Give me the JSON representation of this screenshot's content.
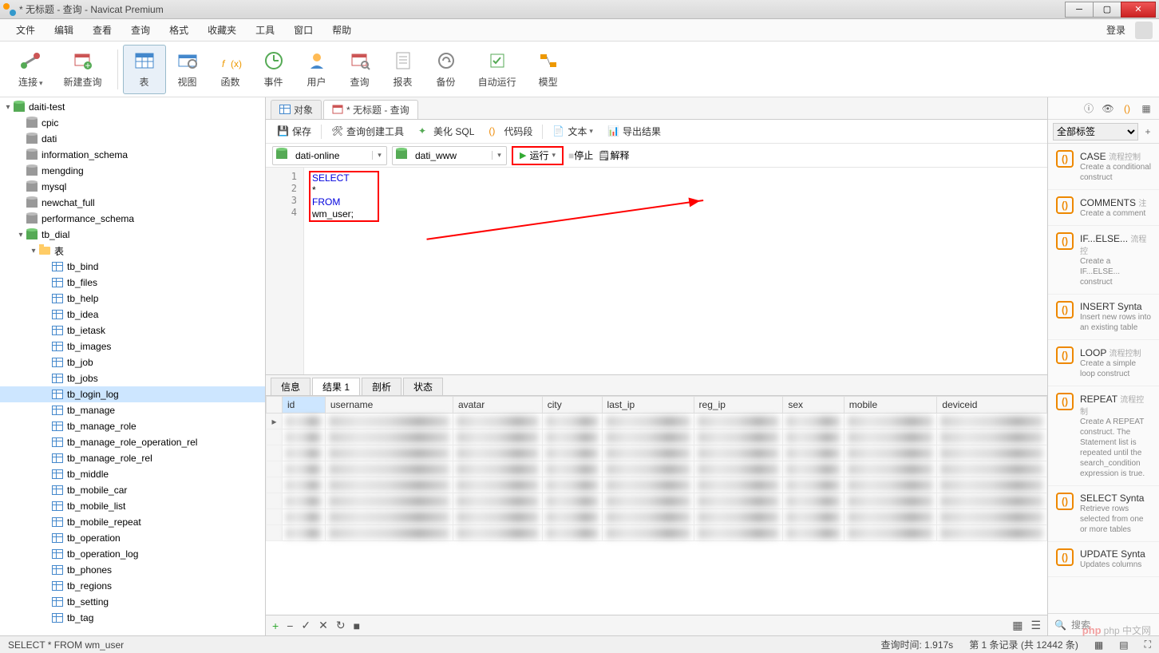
{
  "window": {
    "title": "* 无标题 - 查询 - Navicat Premium"
  },
  "menu": {
    "items": [
      "文件",
      "编辑",
      "查看",
      "查询",
      "格式",
      "收藏夹",
      "工具",
      "窗口",
      "帮助"
    ],
    "login": "登录"
  },
  "toolbar": {
    "connect": "连接",
    "new_query": "新建查询",
    "table": "表",
    "view": "视图",
    "function": "函数",
    "event": "事件",
    "user": "用户",
    "query": "查询",
    "report": "报表",
    "backup": "备份",
    "auto_run": "自动运行",
    "model": "模型"
  },
  "tree": {
    "connection": "daiti-test",
    "dbs": [
      "cpic",
      "dati",
      "information_schema",
      "mengding",
      "mysql",
      "newchat_full",
      "performance_schema"
    ],
    "open_db": "tb_dial",
    "tables_label": "表",
    "tables": [
      "tb_bind",
      "tb_files",
      "tb_help",
      "tb_idea",
      "tb_ietask",
      "tb_images",
      "tb_job",
      "tb_jobs",
      "tb_login_log",
      "tb_manage",
      "tb_manage_role",
      "tb_manage_role_operation_rel",
      "tb_manage_role_rel",
      "tb_middle",
      "tb_mobile_car",
      "tb_mobile_list",
      "tb_mobile_repeat",
      "tb_operation",
      "tb_operation_log",
      "tb_phones",
      "tb_regions",
      "tb_setting",
      "tb_tag"
    ],
    "selected_table": "tb_login_log"
  },
  "tabs": {
    "objects": "对象",
    "query_tab": "* 无标题 - 查询"
  },
  "qtoolbar": {
    "save": "保存",
    "builder": "查询创建工具",
    "beautify": "美化 SQL",
    "snippet": "代码段",
    "text": "文本",
    "export": "导出结果"
  },
  "conn": {
    "connection": "dati-online",
    "database": "dati_www",
    "run": "运行",
    "stop": "停止",
    "explain": "解释"
  },
  "sql": {
    "l1": "SELECT",
    "l2": "  *",
    "l3": "FROM",
    "l4": "  wm_user;"
  },
  "rtabs": {
    "info": "信息",
    "result": "结果 1",
    "profile": "剖析",
    "status": "状态"
  },
  "columns": [
    "id",
    "username",
    "avatar",
    "city",
    "last_ip",
    "reg_ip",
    "sex",
    "mobile",
    "deviceid"
  ],
  "tag_filter": "全部标签",
  "snippets": [
    {
      "t": "CASE",
      "c": "流程控制",
      "d": "Create a conditional construct"
    },
    {
      "t": "COMMENTS",
      "c": "注",
      "d": "Create a comment"
    },
    {
      "t": "IF...ELSE...",
      "c": "流程控",
      "d": "Create a IF...ELSE... construct"
    },
    {
      "t": "INSERT Synta",
      "c": "",
      "d": "Insert new rows into an existing table"
    },
    {
      "t": "LOOP",
      "c": "流程控制",
      "d": "Create a simple loop construct"
    },
    {
      "t": "REPEAT",
      "c": "流程控制",
      "d": "Create A REPEAT construct. The Statement list is repeated until the search_condition expression is true."
    },
    {
      "t": "SELECT Synta",
      "c": "",
      "d": "Retrieve rows selected from one or more tables"
    },
    {
      "t": "UPDATE Synta",
      "c": "",
      "d": "Updates columns"
    }
  ],
  "search_placeholder": "搜索",
  "status": {
    "sql": "SELECT   *  FROM  wm_user",
    "time": "查询时间: 1.917s",
    "rec": "第 1 条记录 (共 12442 条)"
  },
  "watermark": "php 中文网"
}
